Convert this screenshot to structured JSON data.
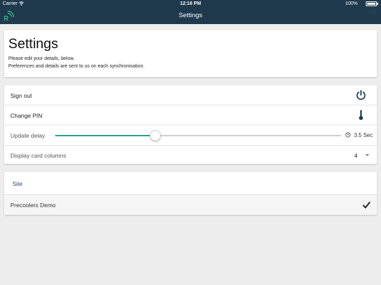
{
  "statusbar": {
    "carrier": "Carrier",
    "time": "12:16 PM",
    "battery": "100%",
    "wifi_icon": "wifi-icon",
    "battery_icon": "battery-icon"
  },
  "navbar": {
    "title": "Settings",
    "logo_icon": "app-logo-icon",
    "faint_text": "TMP",
    "background": "#1f3a4d"
  },
  "header": {
    "title": "Settings",
    "line1": "Please edit your details, below.",
    "line2": "Preferences and details are sent to us on each synchronisation."
  },
  "prefs": {
    "sign_out": {
      "label": "Sign out",
      "icon": "power-icon"
    },
    "change_pin": {
      "label": "Change PIN",
      "icon": "thermometer-icon"
    },
    "update_delay": {
      "label": "Update delay",
      "value_text": "3.5 Sec",
      "slider_fraction": 0.35,
      "icon": "clock-icon",
      "accent": "#27a38a"
    },
    "display_columns": {
      "label": "Display card columns",
      "value": "4",
      "icon": "chevron-down-icon"
    }
  },
  "site": {
    "header": "Site",
    "selected": {
      "label": "Precoolers Demo",
      "icon": "checkmark-icon"
    }
  }
}
